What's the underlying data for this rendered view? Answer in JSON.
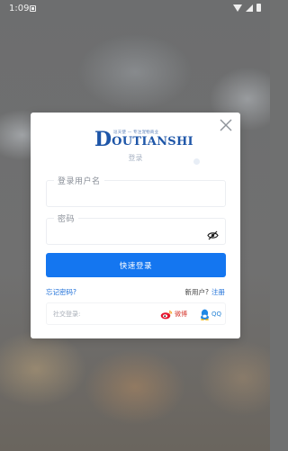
{
  "status_bar": {
    "time": "1:09"
  },
  "dialog": {
    "logo": {
      "slogan": "逗天使 — 专注宠物商业",
      "big_letter": "D",
      "rest_text": "OUTIANSHI"
    },
    "subtitle": "登录",
    "username": {
      "label": "登录用户名",
      "value": ""
    },
    "password": {
      "label": "密码",
      "value": ""
    },
    "submit_label": "快速登录",
    "forgot_password": "忘记密码?",
    "new_user_text": "新用户?",
    "register_link": "注册",
    "social": {
      "label": "社交登录:",
      "weibo_label": "微博",
      "qq_label": "QQ"
    }
  },
  "colors": {
    "primary": "#1476f0",
    "link": "#1d6fd8",
    "logo_blue": "#1e56a8",
    "weibo_red": "#d63b32",
    "qq_blue": "#2a86d6"
  }
}
